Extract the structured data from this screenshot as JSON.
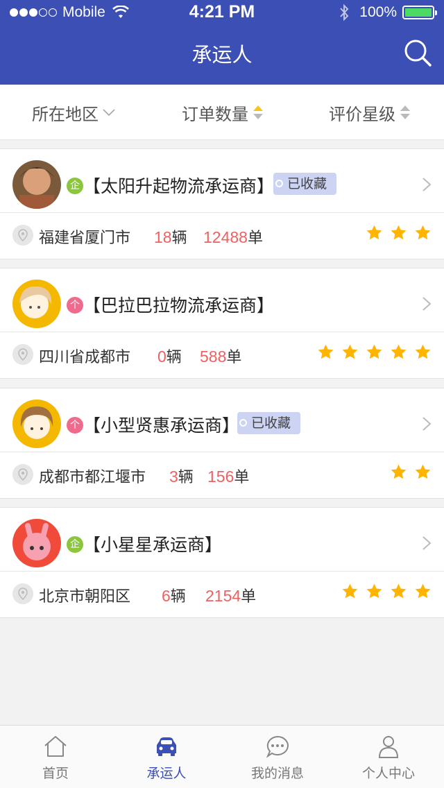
{
  "status_bar": {
    "carrier": "Mobile",
    "time": "4:21 PM",
    "battery": "100%",
    "signal_bars_filled": 3,
    "signal_bars_total": 5
  },
  "nav": {
    "title": "承运人",
    "search_icon": "search-icon"
  },
  "sort": [
    {
      "label": "所在地区",
      "icon": "chevron-down-icon"
    },
    {
      "label": "订单数量",
      "icon": "sort-icon"
    },
    {
      "label": "评价星级",
      "icon": "sort-icon"
    }
  ],
  "carriers": [
    {
      "badge": "企",
      "badge_type": "enterprise",
      "name": "【太阳升起物流承运商】",
      "favorite": "已收藏",
      "location": "福建省厦门市",
      "vehicles": "18",
      "vehicles_unit": "辆",
      "orders": "12488",
      "orders_unit": "单",
      "rating": 3
    },
    {
      "badge": "个",
      "badge_type": "individual",
      "name": "【巴拉巴拉物流承运商】",
      "favorite": "",
      "location": "四川省成都市",
      "vehicles": "0",
      "vehicles_unit": "辆",
      "orders": "588",
      "orders_unit": "单",
      "rating": 5
    },
    {
      "badge": "个",
      "badge_type": "individual",
      "name": "【小型贤惠承运商】",
      "favorite": "已收藏",
      "location": "成都市都江堰市",
      "vehicles": "3",
      "vehicles_unit": "辆",
      "orders": "156",
      "orders_unit": "单",
      "rating": 2
    },
    {
      "badge": "企",
      "badge_type": "enterprise",
      "name": "【小星星承运商】",
      "favorite": "",
      "location": "北京市朝阳区",
      "vehicles": "6",
      "vehicles_unit": "辆",
      "orders": "2154",
      "orders_unit": "单",
      "rating": 4
    }
  ],
  "tabs": [
    {
      "label": "首页",
      "icon": "home-icon",
      "active": false
    },
    {
      "label": "承运人",
      "icon": "car-icon",
      "active": true
    },
    {
      "label": "我的消息",
      "icon": "chat-icon",
      "active": false
    },
    {
      "label": "个人中心",
      "icon": "user-icon",
      "active": false
    }
  ],
  "colors": {
    "primary": "#3c4fb4",
    "accent_number": "#f06060",
    "star": "#ffb400",
    "enterprise_badge": "#8cc63f",
    "individual_badge": "#f06a8b",
    "favorite_tag": "#ccd3f3"
  }
}
